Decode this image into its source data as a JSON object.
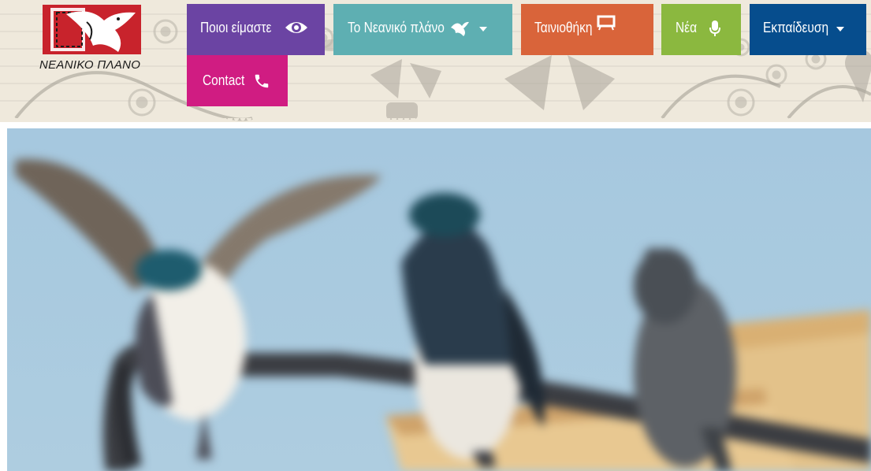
{
  "logo": {
    "text": "ΝΕΑΝΙΚΟ ΠΛΑΝΟ",
    "colors": {
      "mark": "#c8232c",
      "birds": "#ffffff"
    }
  },
  "nav": {
    "about": {
      "label": "Ποιοι είμαστε",
      "icon": "eye-icon",
      "color": "#6b44a3"
    },
    "plan": {
      "label": "Το Νεανικό πλάνο",
      "icon": "bird-icon",
      "has_dropdown": true,
      "color": "#5eafb2"
    },
    "films": {
      "label": "Ταινιοθήκη",
      "icon": "screen-icon",
      "color": "#d9643a"
    },
    "news": {
      "label": "Νέα",
      "icon": "microphone-icon",
      "color": "#8bb83f"
    },
    "education": {
      "label": "Εκπαίδευση",
      "has_dropdown": true,
      "color": "#064d8d"
    },
    "contact": {
      "label": "Contact",
      "icon": "phone-icon",
      "color": "#d01c82"
    }
  },
  "hero": {
    "image": "blurred-swallows-on-metal-rail",
    "colors": {
      "sky": "#a9cadf",
      "wood": "#e3c28a"
    }
  }
}
